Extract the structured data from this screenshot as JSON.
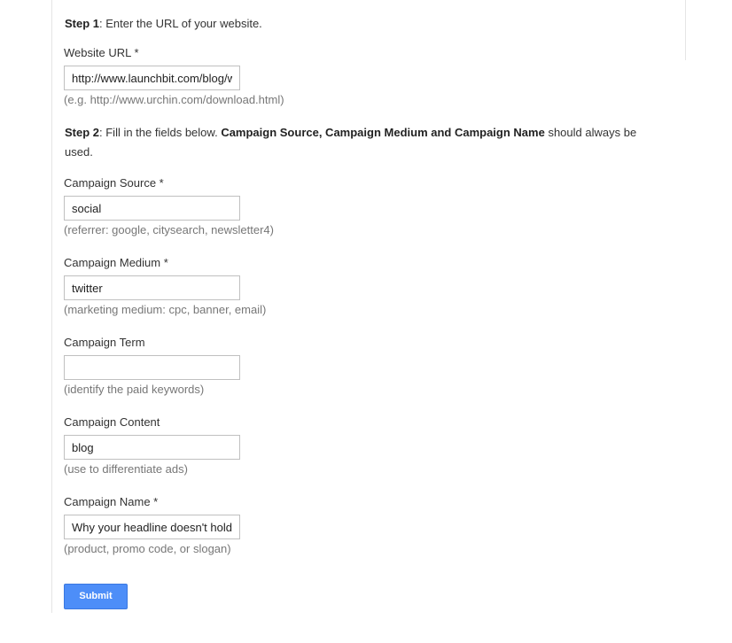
{
  "step1": {
    "label": "Step 1",
    "text": ": Enter the URL of your website."
  },
  "step2": {
    "label": "Step 2",
    "text_a": ": Fill in the fields below. ",
    "bold": "Campaign Source, Campaign Medium and Campaign Name",
    "text_b": " should always be used."
  },
  "fields": {
    "url": {
      "label": "Website URL *",
      "value": "http://www.launchbit.com/blog/w",
      "hint": "(e.g. http://www.urchin.com/download.html)"
    },
    "source": {
      "label": "Campaign Source *",
      "value": "social",
      "hint": "(referrer: google, citysearch, newsletter4)"
    },
    "medium": {
      "label": "Campaign Medium *",
      "value": "twitter",
      "hint": "(marketing medium: cpc, banner, email)"
    },
    "term": {
      "label": "Campaign Term",
      "value": "",
      "hint": "(identify the paid keywords)"
    },
    "content": {
      "label": "Campaign Content",
      "value": "blog",
      "hint": "(use to differentiate ads)"
    },
    "name": {
      "label": "Campaign Name *",
      "value": "Why your headline doesn't hold",
      "hint": "(product, promo code, or slogan)"
    }
  },
  "submit_label": "Submit",
  "colors": {
    "button": "#4d8ef8",
    "hint": "#777777",
    "input_border": "#c0c0c0"
  }
}
